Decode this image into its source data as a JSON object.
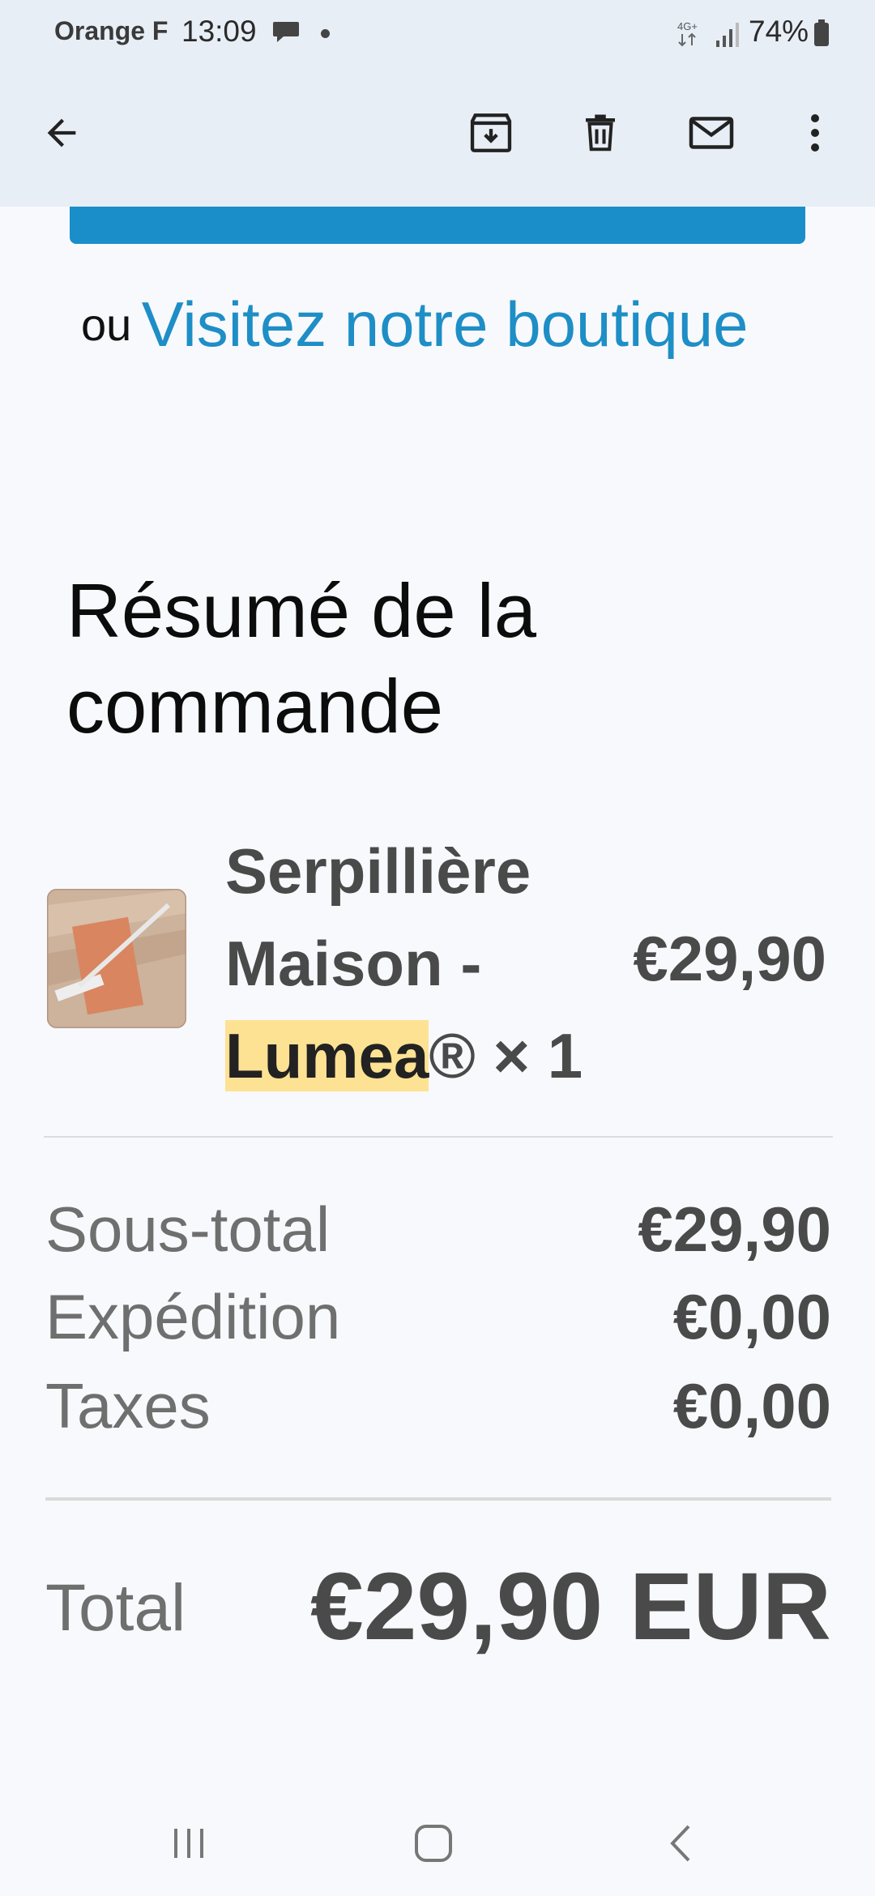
{
  "status_bar": {
    "carrier": "Orange F",
    "time": "13:09",
    "battery": "74%",
    "network": "4G+"
  },
  "toolbar": {
    "back_icon": "arrow-left-icon",
    "archive_icon": "archive-icon",
    "delete_icon": "trash-icon",
    "mail_icon": "mail-icon",
    "more_icon": "more-vert-icon"
  },
  "content": {
    "shop_prefix": "ou",
    "shop_link": "Visitez notre boutique",
    "summary_title": "Résumé de la commande",
    "item": {
      "name_part1": "Serpillière Maison - ",
      "name_highlight": "Lumea",
      "name_part2": "® × 1",
      "price": "€29,90"
    },
    "rows": [
      {
        "label": "Sous-total",
        "value": "€29,90"
      },
      {
        "label": "Expédition",
        "value": "€0,00"
      },
      {
        "label": "Taxes",
        "value": "€0,00"
      }
    ],
    "total_label": "Total",
    "total_value": "€29,90 EUR"
  },
  "colors": {
    "accent": "#1a8ec9",
    "link": "#1e8ec6",
    "highlight": "#fde293",
    "header_bg": "#e8eef6"
  }
}
